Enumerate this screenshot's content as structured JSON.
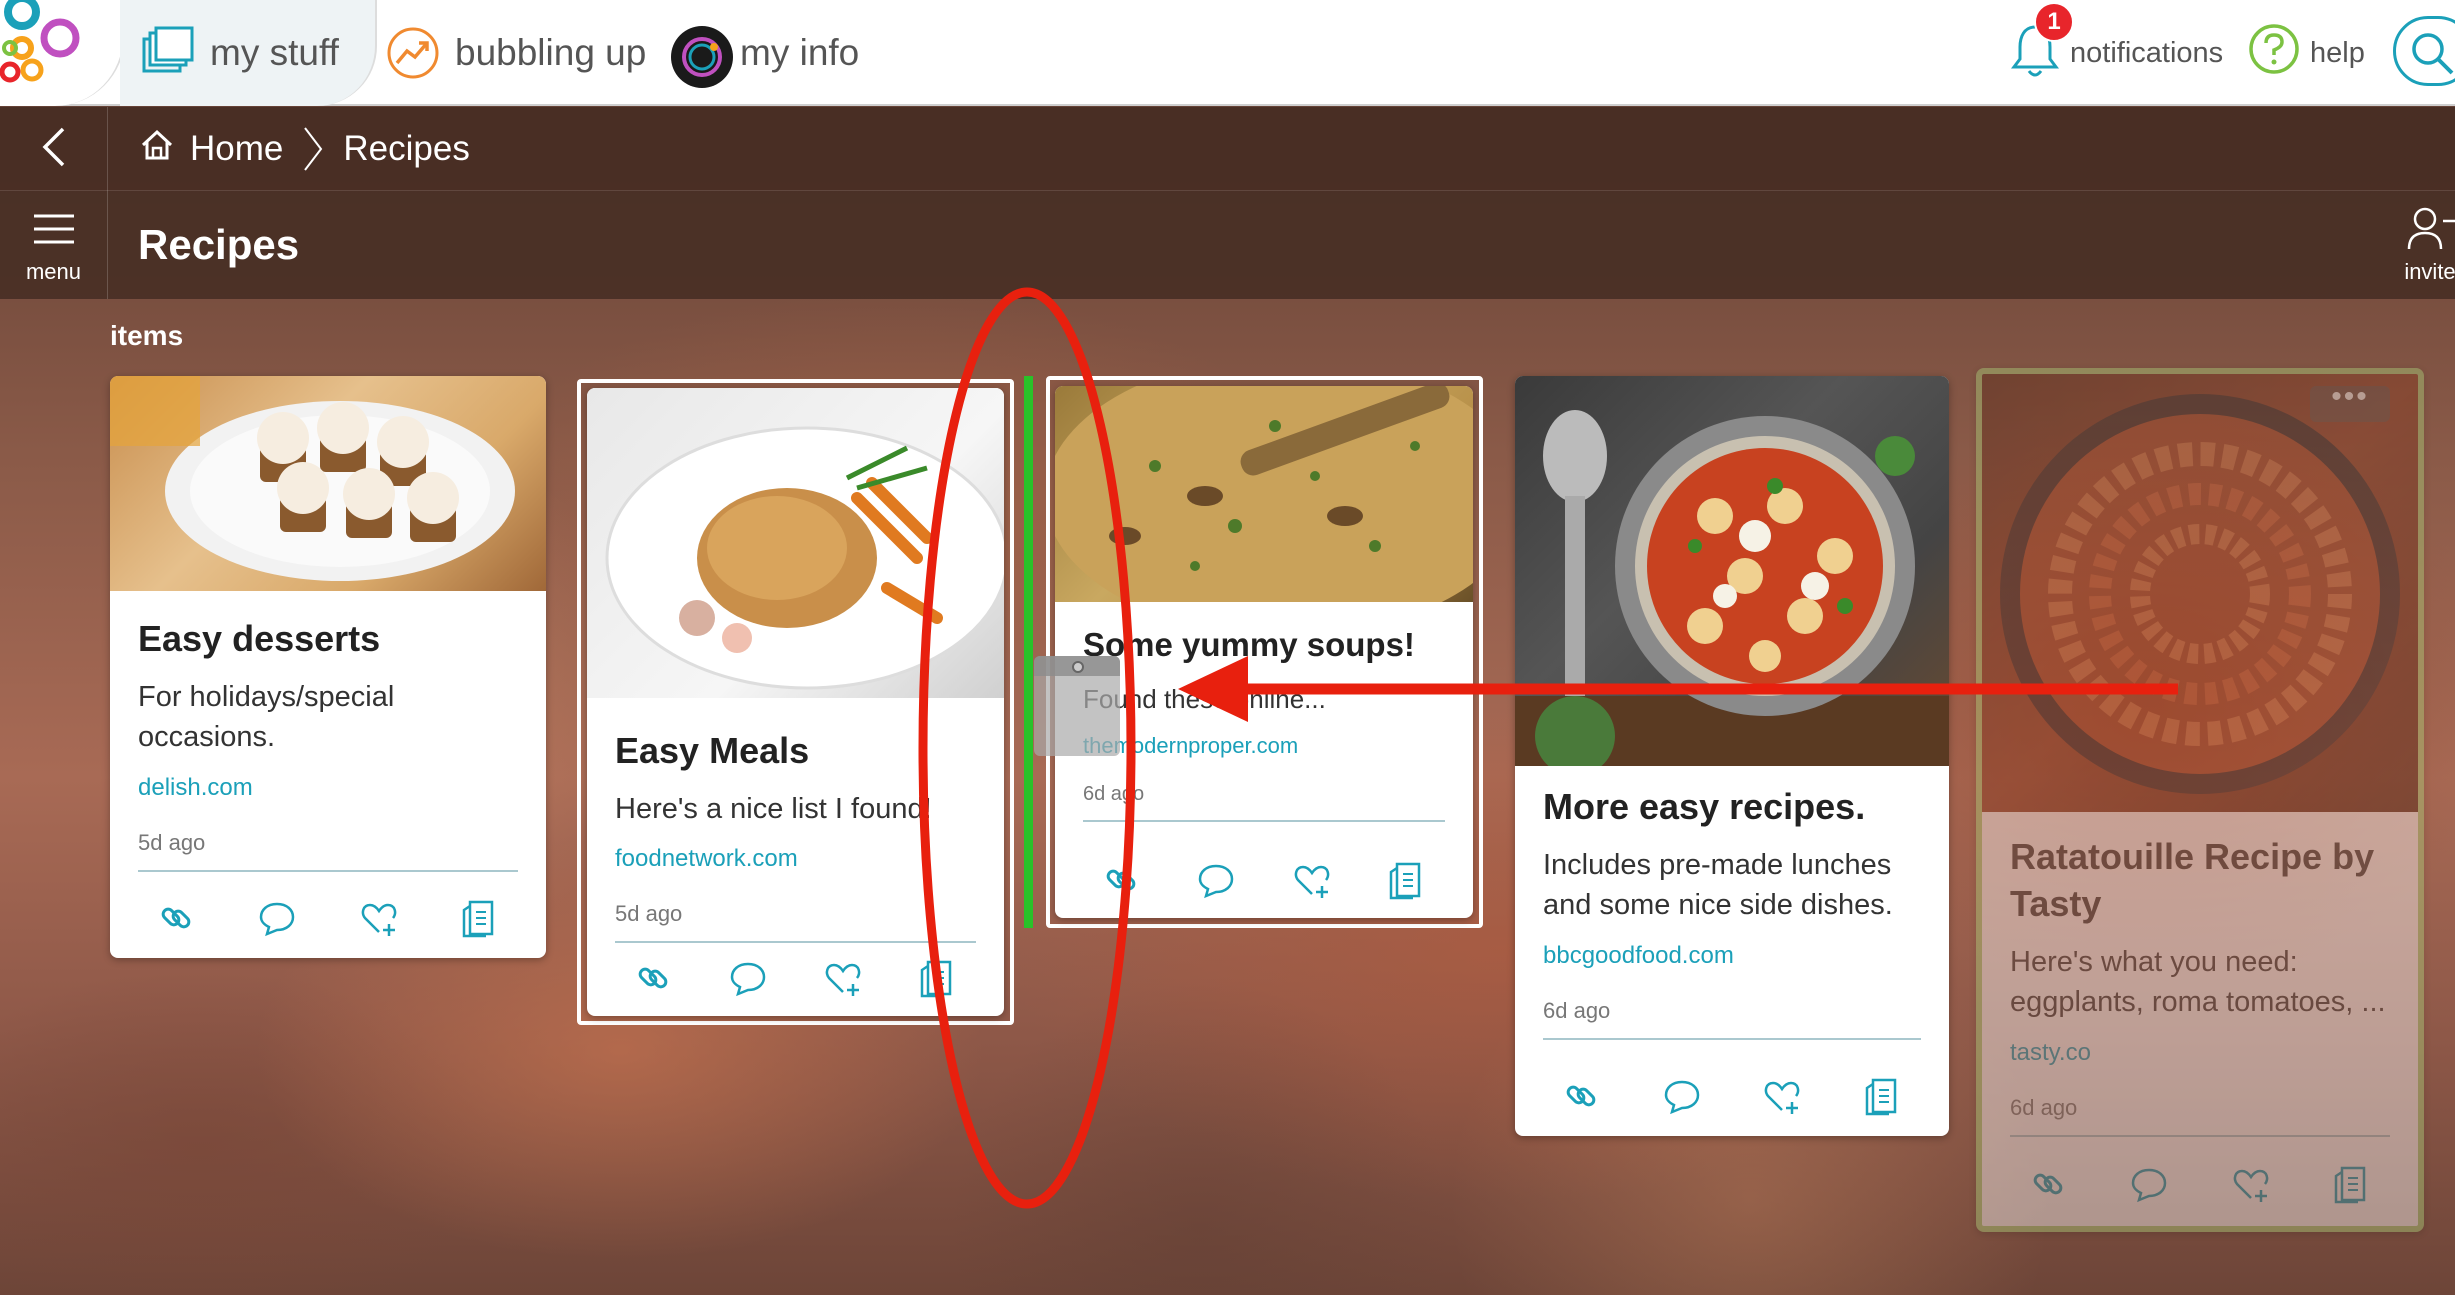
{
  "nav": {
    "tabs": [
      {
        "label": "my stuff"
      },
      {
        "label": "bubbling up"
      },
      {
        "label": "my info"
      }
    ],
    "notifications_label": "notifications",
    "notifications_count": "1",
    "help_label": "help"
  },
  "breadcrumb": {
    "home": "Home",
    "current": "Recipes"
  },
  "page": {
    "title": "Recipes",
    "menu_label": "menu",
    "invite_label": "invite",
    "section_label": "items"
  },
  "cards": [
    {
      "title": "Easy desserts",
      "desc": "For holidays/special occasions.",
      "link": "delish.com",
      "age": "5d ago"
    },
    {
      "title": "Easy Meals",
      "desc": "Here's a nice list I found!",
      "link": "foodnetwork.com",
      "age": "5d ago"
    },
    {
      "title": "Some yummy soups!",
      "desc": "Found these online...",
      "link": "themodernproper.com",
      "age": "6d ago"
    },
    {
      "title": "More easy recipes.",
      "desc": "Includes pre-made lunches and some nice side dishes.",
      "link": "bbcgoodfood.com",
      "age": "6d ago"
    },
    {
      "title": "Ratatouille Recipe by Tasty",
      "desc": "Here's what you need: eggplants, roma tomatoes, ...",
      "link": "tasty.co",
      "age": "6d ago"
    }
  ],
  "colors": {
    "accent": "#1ba0b9",
    "drop_indicator": "#29c229",
    "annotation": "#e8200e",
    "badge": "#e8252b"
  }
}
